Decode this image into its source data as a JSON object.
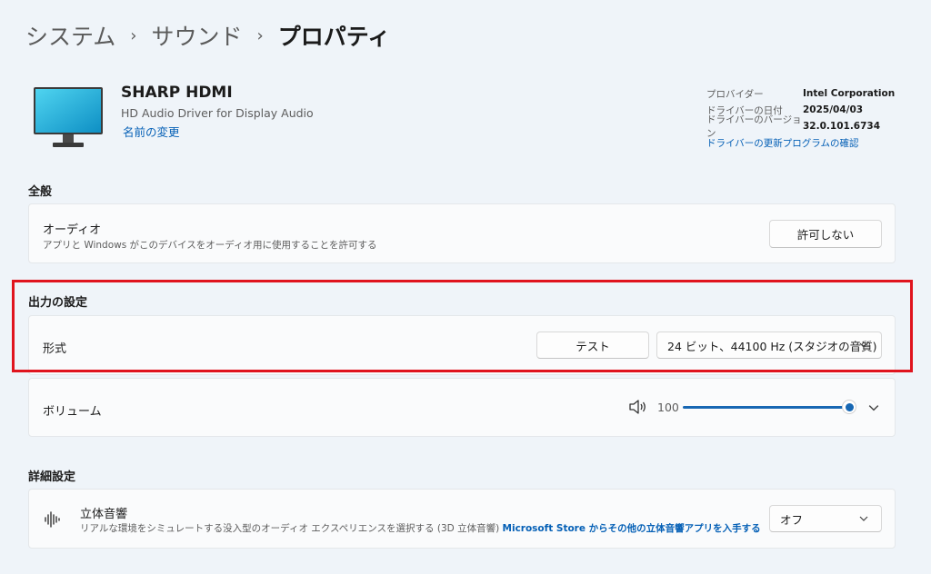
{
  "breadcrumb": {
    "items": [
      "システム",
      "サウンド",
      "プロパティ"
    ],
    "separator": "›"
  },
  "device": {
    "name": "SHARP HDMI",
    "driver_desc": "HD Audio Driver for Display Audio",
    "rename_link": "名前の変更"
  },
  "driver_info": {
    "rows": [
      {
        "key": "プロバイダー",
        "value": "Intel Corporation"
      },
      {
        "key": "ドライバーの日付",
        "value": "2025/04/03"
      },
      {
        "key": "ドライバーのバージョン",
        "value": "32.0.101.6734"
      }
    ],
    "update_link": "ドライバーの更新プログラムの確認"
  },
  "general": {
    "heading": "全般",
    "audio_title": "オーディオ",
    "audio_desc": "アプリと Windows がこのデバイスをオーディオ用に使用することを許可する",
    "audio_button": "許可しない"
  },
  "output": {
    "heading": "出力の設定",
    "format_label": "形式",
    "test_button": "テスト",
    "format_selected": "24 ビット、44100 Hz (スタジオの音質)"
  },
  "volume": {
    "label": "ボリューム",
    "value": "100",
    "level_fraction": 1.0
  },
  "advanced": {
    "heading": "詳細設定",
    "spatial_title": "立体音響",
    "spatial_desc": "リアルな環境をシミュレートする没入型のオーディオ エクスペリエンスを選択する (3D 立体音響)",
    "spatial_link": "Microsoft Store からその他の立体音響アプリを入手する",
    "spatial_selected": "オフ"
  },
  "colors": {
    "accent": "#1767b3",
    "link": "#0560b6",
    "highlight_box": "#e0141e"
  },
  "icons": [
    "monitor-icon",
    "chevron-right-icon",
    "chevron-down-icon",
    "speaker-icon",
    "spatial-sound-icon"
  ]
}
